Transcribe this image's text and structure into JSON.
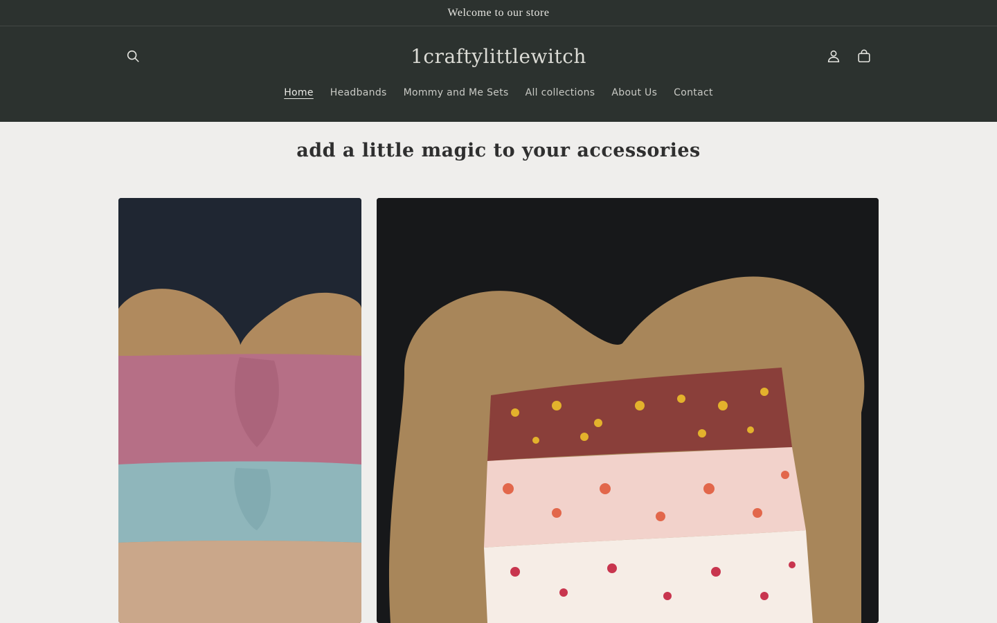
{
  "announcement": {
    "text": "Welcome to our store"
  },
  "header": {
    "logo": "1craftylittlewitch",
    "icons": {
      "search": "search-icon",
      "account": "account-icon",
      "cart": "cart-icon"
    }
  },
  "nav": {
    "items": [
      {
        "label": "Home",
        "active": true
      },
      {
        "label": "Headbands",
        "active": false
      },
      {
        "label": "Mommy and Me Sets",
        "active": false
      },
      {
        "label": "All collections",
        "active": false
      },
      {
        "label": "About Us",
        "active": false
      },
      {
        "label": "Contact",
        "active": false
      }
    ]
  },
  "hero": {
    "tagline_before": "add a little ",
    "tagline_emphasis": "magic",
    "tagline_after": " to your accessories"
  },
  "colors": {
    "header_bg": "#2c322f",
    "page_bg": "#efeeec"
  }
}
